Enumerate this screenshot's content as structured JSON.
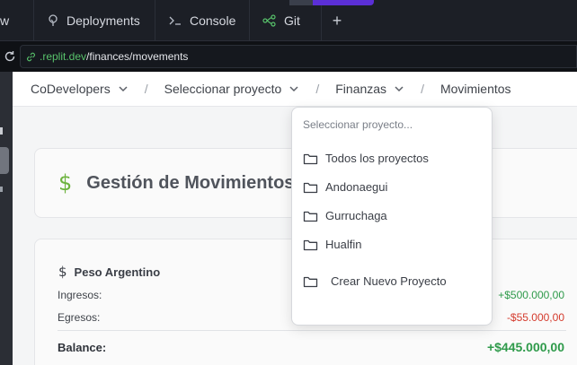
{
  "tabs": [
    {
      "label": "w",
      "icon": ""
    },
    {
      "label": "Deployments",
      "icon": "deployments-icon"
    },
    {
      "label": "Console",
      "icon": "console-icon"
    },
    {
      "label": "Git",
      "icon": "git-icon"
    }
  ],
  "url": {
    "host": ".replit.dev",
    "path": "/finances/movements"
  },
  "breadcrumb": {
    "org": "CoDevelopers",
    "project": "Seleccionar proyecto",
    "section": "Finanzas",
    "page": "Movimientos",
    "separator": "/"
  },
  "header": {
    "currency_symbol": "$",
    "title": "Gestión de Movimientos"
  },
  "peso": {
    "currency_symbol": "$",
    "name": "Peso Argentino",
    "income_label": "Ingresos:",
    "income_value": "+$500.000,00",
    "expense_label": "Egresos:",
    "expense_value": "-$55.000,00",
    "balance_label": "Balance:",
    "balance_value": "+$445.000,00"
  },
  "dropdown": {
    "placeholder": "Seleccionar proyecto...",
    "items": [
      "Todos los proyectos",
      "Andonaegui",
      "Gurruchaga",
      "Hualfin"
    ],
    "create_label": "Crear Nuevo Proyecto"
  },
  "colors": {
    "accent": "#5b2fd6",
    "positive": "#2e9a4a",
    "negative": "#d43b2d",
    "dollar_icon": "#6db33f"
  }
}
